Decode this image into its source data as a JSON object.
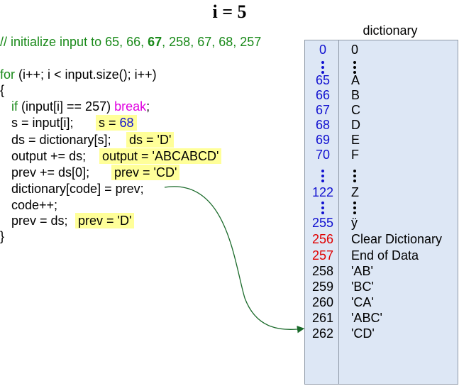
{
  "title": "i = 5",
  "comment": {
    "prefix": "// initialize input to 65, 66, ",
    "bold": "67",
    "suffix": ", 258, 67, 68, 257"
  },
  "code": {
    "for_kw": "for",
    "for_rest": " (i++; i < input.size(); i++)",
    "open_brace": "{",
    "if_kw": "if",
    "if_mid": " (input[i] == 257) ",
    "break_kw": "break",
    "if_end": ";",
    "line_s": "s = input[i];",
    "line_ds": "ds = dictionary[s];",
    "line_output": "output += ds;",
    "line_prev": "prev += ds[0];",
    "line_dict": "dictionary[code] = prev;",
    "line_code": "code++;",
    "line_prev2": "prev = ds;",
    "close_brace": "}"
  },
  "annotations": {
    "s_label": "s = ",
    "s_value": "68",
    "ds": "ds = 'D'",
    "output": "output = 'ABCABCD'",
    "prev": "prev = 'CD'",
    "prev2": "prev = 'D'"
  },
  "dictionary": {
    "title": "dictionary",
    "entries": [
      {
        "key": "0",
        "value": "0",
        "color": "blue"
      },
      {
        "key": "65",
        "value": "A",
        "color": "blue"
      },
      {
        "key": "66",
        "value": "B",
        "color": "blue"
      },
      {
        "key": "67",
        "value": "C",
        "color": "blue"
      },
      {
        "key": "68",
        "value": "D",
        "color": "blue"
      },
      {
        "key": "69",
        "value": "E",
        "color": "blue"
      },
      {
        "key": "70",
        "value": "F",
        "color": "blue"
      },
      {
        "key": "122",
        "value": "Z",
        "color": "blue"
      },
      {
        "key": "255",
        "value": "ÿ",
        "color": "blue"
      },
      {
        "key": "256",
        "value": "Clear Dictionary",
        "color": "red"
      },
      {
        "key": "257",
        "value": "End of Data",
        "color": "red"
      },
      {
        "key": "258",
        "value": "'AB'",
        "color": "black"
      },
      {
        "key": "259",
        "value": "'BC'",
        "color": "black"
      },
      {
        "key": "260",
        "value": "'CA'",
        "color": "black"
      },
      {
        "key": "261",
        "value": "'ABC'",
        "color": "black"
      },
      {
        "key": "262",
        "value": "'CD'",
        "color": "black"
      }
    ]
  },
  "colors": {
    "keyword_green": "#1a8a1a",
    "keyword_magenta": "#e000e0",
    "index_blue": "#1010d0",
    "index_red": "#e00000",
    "highlight": "#ffff99",
    "dict_background": "#dde7f5",
    "arrow": "#1a6a2a"
  }
}
